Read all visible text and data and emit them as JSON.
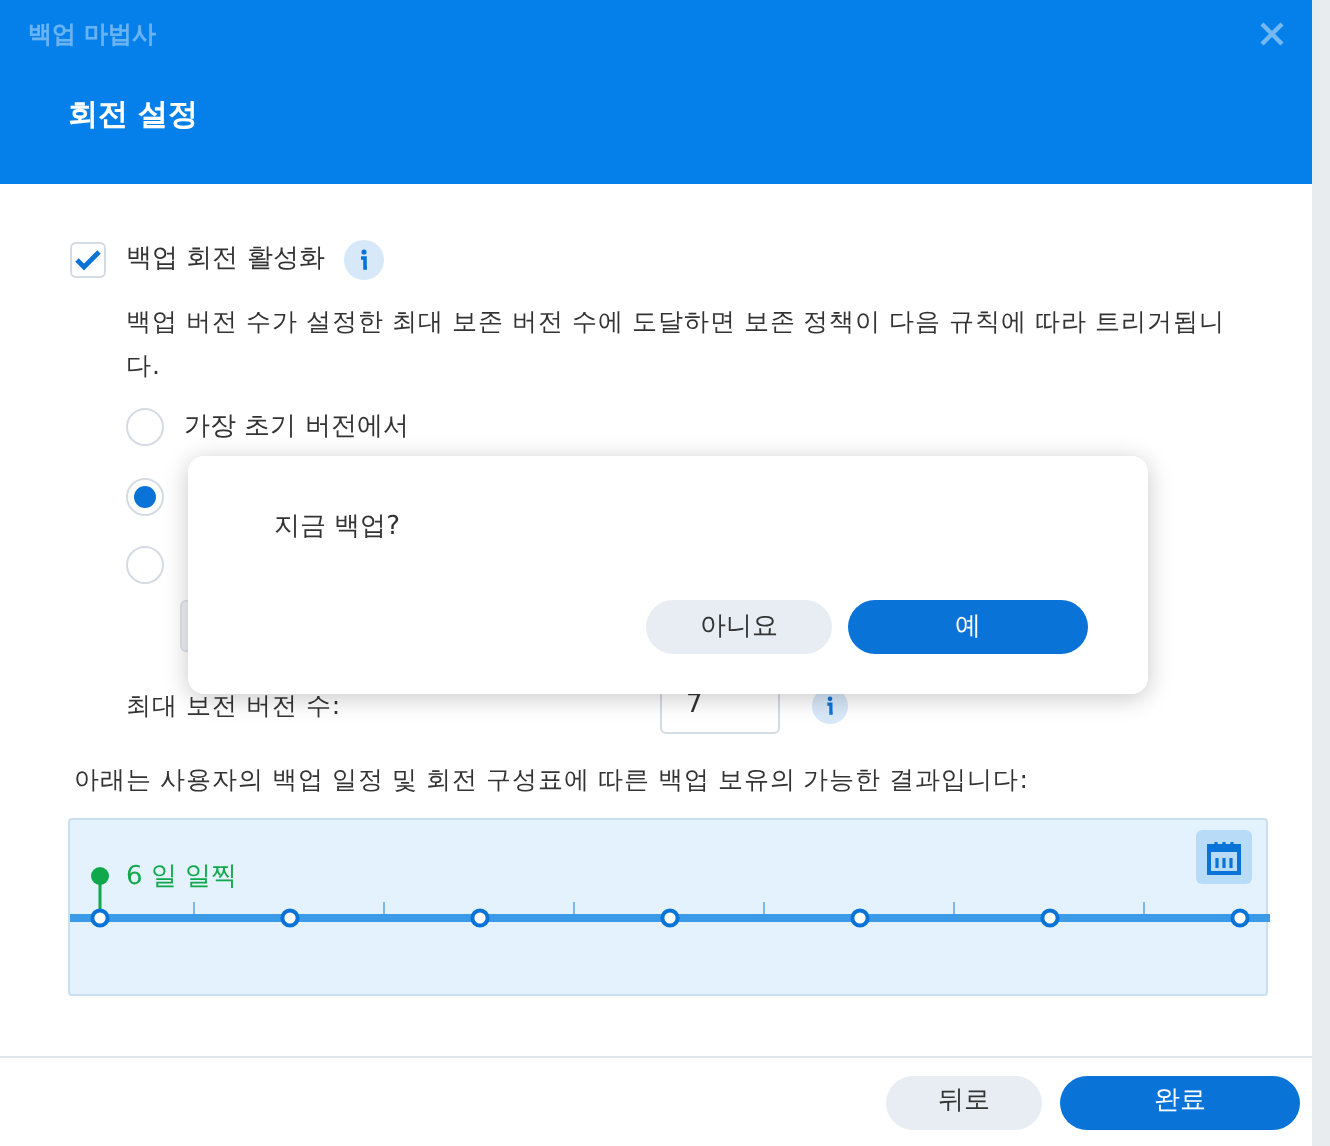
{
  "window": {
    "title": "백업 마법사"
  },
  "page_title": "회전 설정",
  "rotation": {
    "label": "백업 회전 활성화",
    "checked": true
  },
  "description": "백업 버전 수가 설정한 최대 보존 버전 수에 도달하면 보존 정책이 다음 규칙에 따라 트리거됩니다.",
  "rules": [
    {
      "label": "가장 초기 버전에서",
      "selected": false
    },
    {
      "selected": true
    },
    {
      "selected": false
    }
  ],
  "max_versions": {
    "label": "최대 보전 버전 수:",
    "value": "7"
  },
  "result_text": "아래는 사용자의 백업 일정 및 회전 구성표에 따른 백업 보유의 가능한 결과입니다:",
  "timeline": {
    "label": "6 일 일찍"
  },
  "footer_buttons": [
    {
      "label": "뒤로",
      "kind": "secondary"
    },
    {
      "label": "완료",
      "kind": "primary"
    }
  ],
  "dialog": {
    "message": "지금 백업?",
    "buttons": [
      {
        "label": "아니요",
        "kind": "secondary"
      },
      {
        "label": "예",
        "kind": "primary"
      }
    ]
  }
}
